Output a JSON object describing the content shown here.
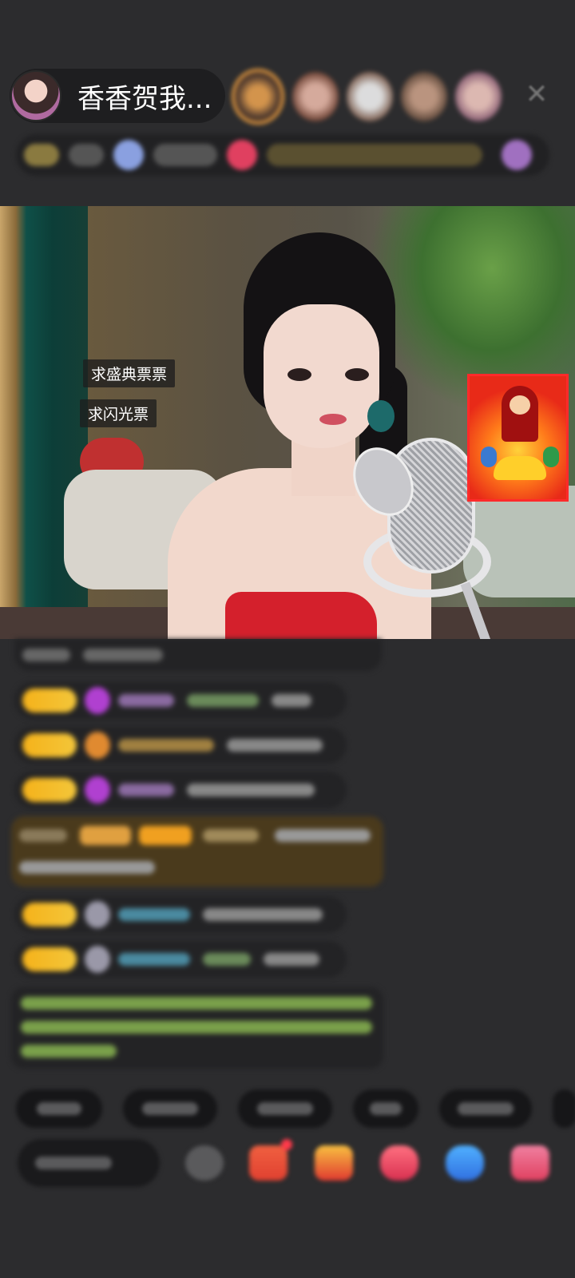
{
  "host": {
    "name": "香香贺我...",
    "avatar": "streamer-avatar"
  },
  "header": {
    "viewer_avatars": [
      "top-fan-avatar",
      "fan-avatar",
      "fan-avatar",
      "fan-avatar",
      "fan-avatar"
    ],
    "close_icon": "close-icon",
    "close_glyph": "✕"
  },
  "video": {
    "stickers": [
      "求盛典票票",
      "求闪光票"
    ],
    "fortune_card": "god-of-wealth-sticker"
  },
  "colors": {
    "level_badge": "#f5b21a",
    "highlight_message_bg": "#4a3a1c",
    "system_message_text": "#7aa04a",
    "background": "#2c2c2e"
  },
  "bottom_bar": {
    "icons": [
      "emoji-icon",
      "gift-box-icon",
      "red-envelope-icon",
      "heart-gift-icon",
      "game-controller-icon",
      "more-gifts-icon"
    ]
  }
}
